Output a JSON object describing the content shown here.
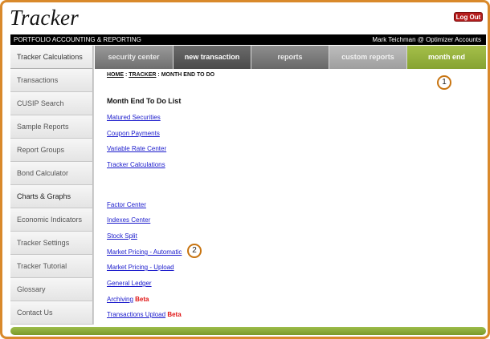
{
  "app": {
    "logo": "Tracker",
    "logout_label": "Log Out"
  },
  "topbar": {
    "title": "PORTFOLIO ACCOUNTING & REPORTING",
    "user": "Mark Teichman @ Optimizer Accounts"
  },
  "sidebar": {
    "items": [
      {
        "label": "Tracker Calculations"
      },
      {
        "label": "Transactions"
      },
      {
        "label": "CUSIP Search"
      },
      {
        "label": "Sample Reports"
      },
      {
        "label": "Report Groups"
      },
      {
        "label": "Bond Calculator"
      },
      {
        "label": "Charts & Graphs"
      },
      {
        "label": "Economic Indicators"
      },
      {
        "label": "Tracker Settings"
      },
      {
        "label": "Tracker Tutorial"
      },
      {
        "label": "Glossary"
      },
      {
        "label": "Contact Us"
      }
    ]
  },
  "tabs": [
    {
      "label": "security center"
    },
    {
      "label": "new transaction"
    },
    {
      "label": "reports"
    },
    {
      "label": "custom reports"
    },
    {
      "label": "month end"
    }
  ],
  "breadcrumb": {
    "home": "HOME",
    "sep1": " : ",
    "tracker": "TRACKER",
    "sep2": " : ",
    "current": "MONTH END TO DO"
  },
  "main": {
    "heading": "Month End To Do List",
    "links": [
      {
        "label": "Matured Securities"
      },
      {
        "label": "Coupon Payments"
      },
      {
        "label": "Variable Rate Center"
      },
      {
        "label": "Tracker Calculations"
      },
      {
        "label": "Factor Center"
      },
      {
        "label": "Indexes Center"
      },
      {
        "label": "Stock Split"
      },
      {
        "label": "Market Pricing - Automatic"
      },
      {
        "label": "Market Pricing - Upload"
      },
      {
        "label": "General Ledger"
      },
      {
        "label": "Archiving",
        "badge": "Beta"
      },
      {
        "label": "Transactions Upload",
        "badge": "Beta"
      }
    ]
  },
  "markers": [
    "1",
    "2"
  ],
  "colors": {
    "frame": "#d9892b",
    "accent_green": "#8aa634",
    "link": "#1a1acc",
    "beta": "#e01515",
    "logout": "#b51d1d"
  }
}
